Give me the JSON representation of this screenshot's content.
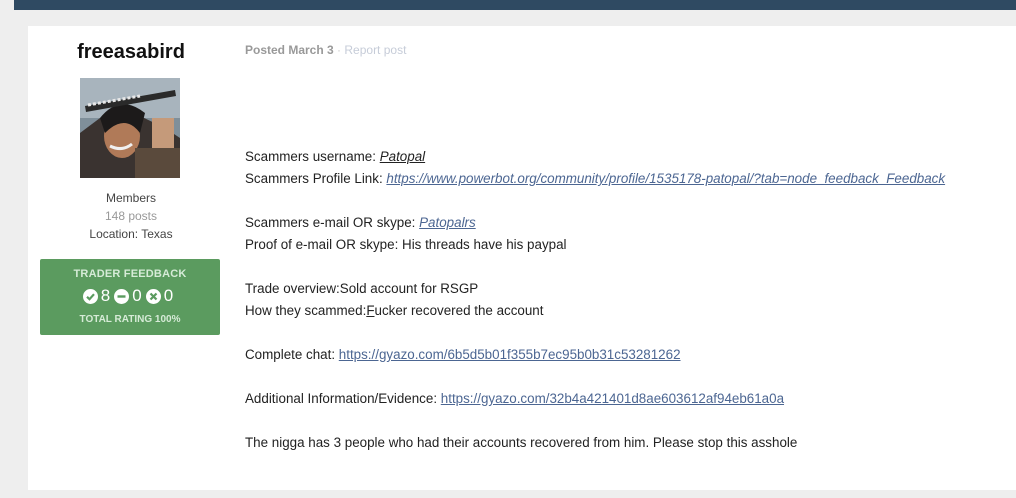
{
  "author": {
    "username": "freeasabird",
    "group": "Members",
    "posts": "148 posts",
    "location": "Location: Texas"
  },
  "feedback": {
    "title": "TRADER FEEDBACK",
    "positive": "8",
    "neutral": "0",
    "negative": "0",
    "total": "TOTAL RATING 100%"
  },
  "post": {
    "posted": "Posted March 3",
    "separator": " · ",
    "report": "Report post",
    "username_label": "Scammers username: ",
    "username_value": "Patopal",
    "profile_label": "Scammers Profile Link: ",
    "profile_link": "https://www.powerbot.org/community/profile/1535178-patopal/?tab=node_feedback_Feedback",
    "email_label": "Scammers e-mail OR skype: ",
    "email_value": "Patopalrs",
    "proof": "Proof of e-mail OR skype: His threads have his paypal",
    "overview": " Trade overview:Sold account for RSGP",
    "how_label": "How they scammed:",
    "how_first": "F",
    "how_rest": "ucker recovered the account",
    "chat_label": "Complete chat: ",
    "chat_link": "https://gyazo.com/6b5d5b01f355b7ec95b0b31c53281262",
    "additional_label": "Additional Information/Evidence: ",
    "additional_link": "https://gyazo.com/32b4a421401d8ae603612af94eb61a0a",
    "closing": "The nigga has 3 people who had their accounts recovered from him. Please stop this asshole"
  }
}
